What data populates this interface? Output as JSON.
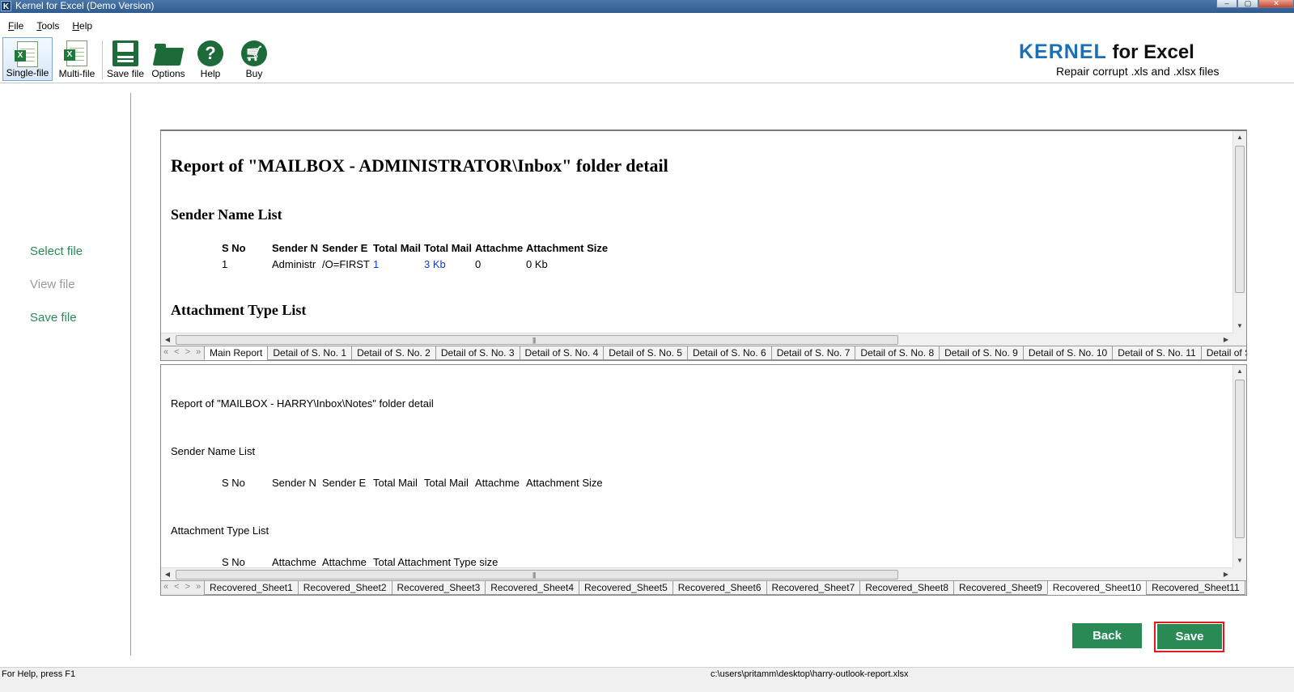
{
  "window": {
    "title": "Kernel for Excel (Demo Version)",
    "app_icon": "K"
  },
  "menu": [
    {
      "underline": "F",
      "rest": "ile"
    },
    {
      "underline": "T",
      "rest": "ools"
    },
    {
      "underline": "H",
      "rest": "elp"
    }
  ],
  "toolbar": {
    "single_file": "Single-file",
    "multi_file": "Multi-file",
    "save_file": "Save file",
    "options": "Options",
    "help": "Help",
    "buy": "Buy"
  },
  "brand": {
    "kernel": "KERNEL",
    "for_excel": " for Excel",
    "tagline": "Repair corrupt .xls and .xlsx files"
  },
  "nav": {
    "select_file": "Select file",
    "view_file": "View file",
    "save_file": "Save file"
  },
  "panel1": {
    "title": "Report of \"MAILBOX - ADMINISTRATOR\\Inbox\" folder detail",
    "sender_list_heading": "Sender Name List",
    "columns": [
      "S No",
      "Sender N",
      "Sender E",
      "Total Mail",
      "Total Mail",
      "Attachme",
      "Attachment Size"
    ],
    "row": [
      "1",
      "Administr",
      "/O=FIRST",
      "1",
      "3 Kb",
      "0",
      "0 Kb"
    ],
    "attachment_heading": "Attachment Type List",
    "tabs": [
      "Main Report",
      "Detail of S. No. 1",
      "Detail of S. No. 2",
      "Detail of S. No. 3",
      "Detail of S. No. 4",
      "Detail of S. No. 5",
      "Detail of S. No. 6",
      "Detail of S. No. 7",
      "Detail of S. No. 8",
      "Detail of S. No. 9",
      "Detail of S. No. 10",
      "Detail of S. No. 11",
      "Detail of S. N"
    ]
  },
  "panel2": {
    "title": "Report of \"MAILBOX - HARRY\\Inbox\\Notes\" folder detail",
    "sender_list_heading": "Sender Name List",
    "columns": [
      "S No",
      "Sender N",
      "Sender E",
      "Total Mail",
      "Total Mail",
      "Attachme",
      "Attachment Size"
    ],
    "attachment_heading": "Attachment Type List",
    "attachment_columns": [
      "S No",
      "Attachme",
      "Attachme",
      "Total Attachment Type size"
    ],
    "tabs": [
      "Recovered_Sheet1",
      "Recovered_Sheet2",
      "Recovered_Sheet3",
      "Recovered_Sheet4",
      "Recovered_Sheet5",
      "Recovered_Sheet6",
      "Recovered_Sheet7",
      "Recovered_Sheet8",
      "Recovered_Sheet9",
      "Recovered_Sheet10",
      "Recovered_Sheet11"
    ],
    "selected_tab": "Recovered_Sheet10"
  },
  "tab_nav": "« < > »",
  "buttons": {
    "back": "Back",
    "save": "Save"
  },
  "status": {
    "help": "For Help, press F1",
    "path": "c:\\users\\pritamm\\desktop\\harry-outlook-report.xlsx"
  },
  "colors": {
    "accent_green": "#2a8a55",
    "brand_blue": "#1c6fb5",
    "highlight_red": "#e11b1b",
    "link_blue": "#1438d8"
  }
}
